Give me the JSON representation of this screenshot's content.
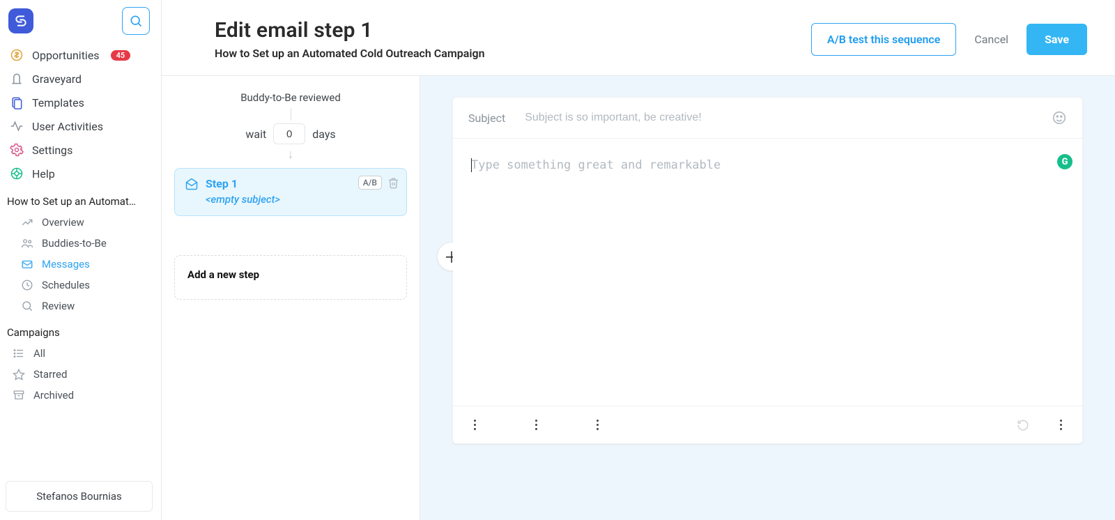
{
  "sidebar": {
    "main_items": [
      {
        "icon": "opportunities",
        "label": "Opportunities",
        "badge": "45"
      },
      {
        "icon": "graveyard",
        "label": "Graveyard"
      },
      {
        "icon": "templates",
        "label": "Templates"
      },
      {
        "icon": "activities",
        "label": "User Activities"
      },
      {
        "icon": "settings",
        "label": "Settings"
      },
      {
        "icon": "help",
        "label": "Help"
      }
    ],
    "campaign_title": "How to Set up an Automat…",
    "campaign_items": [
      {
        "icon": "overview",
        "label": "Overview"
      },
      {
        "icon": "buddies",
        "label": "Buddies-to-Be"
      },
      {
        "icon": "messages",
        "label": "Messages",
        "active": true
      },
      {
        "icon": "schedules",
        "label": "Schedules"
      },
      {
        "icon": "review",
        "label": "Review"
      }
    ],
    "campaigns_header": "Campaigns",
    "campaigns_items": [
      {
        "icon": "all",
        "label": "All"
      },
      {
        "icon": "starred",
        "label": "Starred"
      },
      {
        "icon": "archived",
        "label": "Archived"
      }
    ],
    "user_name": "Stefanos Bournias"
  },
  "header": {
    "title": "Edit email step 1",
    "subtitle": "How to Set up an Automated Cold Outreach Campaign",
    "ab_test_label": "A/B test this sequence",
    "cancel_label": "Cancel",
    "save_label": "Save"
  },
  "steps": {
    "reviewed_label": "Buddy-to-Be reviewed",
    "wait_prefix": "wait",
    "wait_value": "0",
    "wait_suffix": "days",
    "step1_title": "Step 1",
    "step1_subject": "<empty subject>",
    "ab_badge": "A/B",
    "add_step_label": "Add a new step"
  },
  "editor": {
    "subject_label": "Subject",
    "subject_placeholder": "Subject is so important, be creative!",
    "body_placeholder": "Type something great and remarkable",
    "grammarly_badge": "G"
  }
}
